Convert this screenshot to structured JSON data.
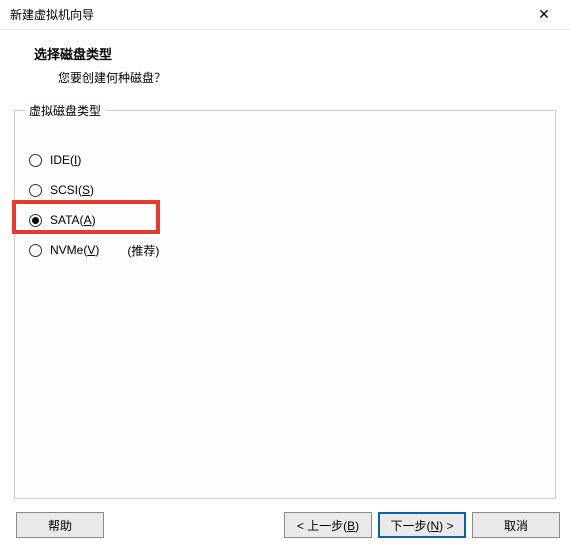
{
  "window": {
    "title": "新建虚拟机向导",
    "close_glyph": "✕"
  },
  "header": {
    "title": "选择磁盘类型",
    "subtitle": "您要创建何种磁盘？"
  },
  "group": {
    "label": "虚拟磁盘类型"
  },
  "options": {
    "ide": {
      "prefix": "IDE(",
      "mnemonic": "I",
      "suffix": ")"
    },
    "scsi": {
      "prefix": "SCSI(",
      "mnemonic": "S",
      "suffix": ")"
    },
    "sata": {
      "prefix": "SATA(",
      "mnemonic": "A",
      "suffix": ")"
    },
    "nvme": {
      "prefix": "NVMe(",
      "mnemonic": "V",
      "suffix": ")",
      "extra": "(推荐)"
    }
  },
  "buttons": {
    "help": "帮助",
    "back_prefix": "< 上一步(",
    "back_mnemonic": "B",
    "back_suffix": ")",
    "next_prefix": "下一步(",
    "next_mnemonic": "N",
    "next_suffix": ") >",
    "cancel": "取消"
  }
}
